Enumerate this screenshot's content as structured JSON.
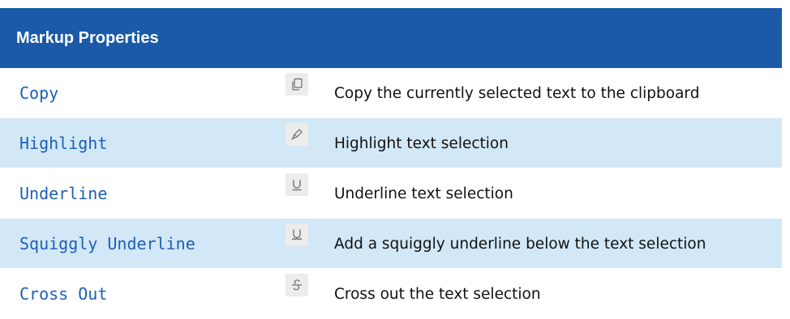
{
  "table": {
    "header": "Markup Properties",
    "rows": [
      {
        "name": "Copy",
        "icon": "copy-icon",
        "description": "Copy the currently selected text to the clipboard"
      },
      {
        "name": "Highlight",
        "icon": "highlighter-icon",
        "description": "Highlight text selection"
      },
      {
        "name": "Underline",
        "icon": "underline-icon",
        "description": "Underline text selection"
      },
      {
        "name": "Squiggly Underline",
        "icon": "squiggly-underline-icon",
        "description": "Add a squiggly underline below the text selection"
      },
      {
        "name": "Cross Out",
        "icon": "strikethrough-icon",
        "description": "Cross out the text selection"
      }
    ]
  },
  "colors": {
    "header_bg": "#1a5aa8",
    "row_alt_bg": "#d3e8f7",
    "name_text": "#1d5fb8",
    "icon_bg": "#ececec"
  }
}
